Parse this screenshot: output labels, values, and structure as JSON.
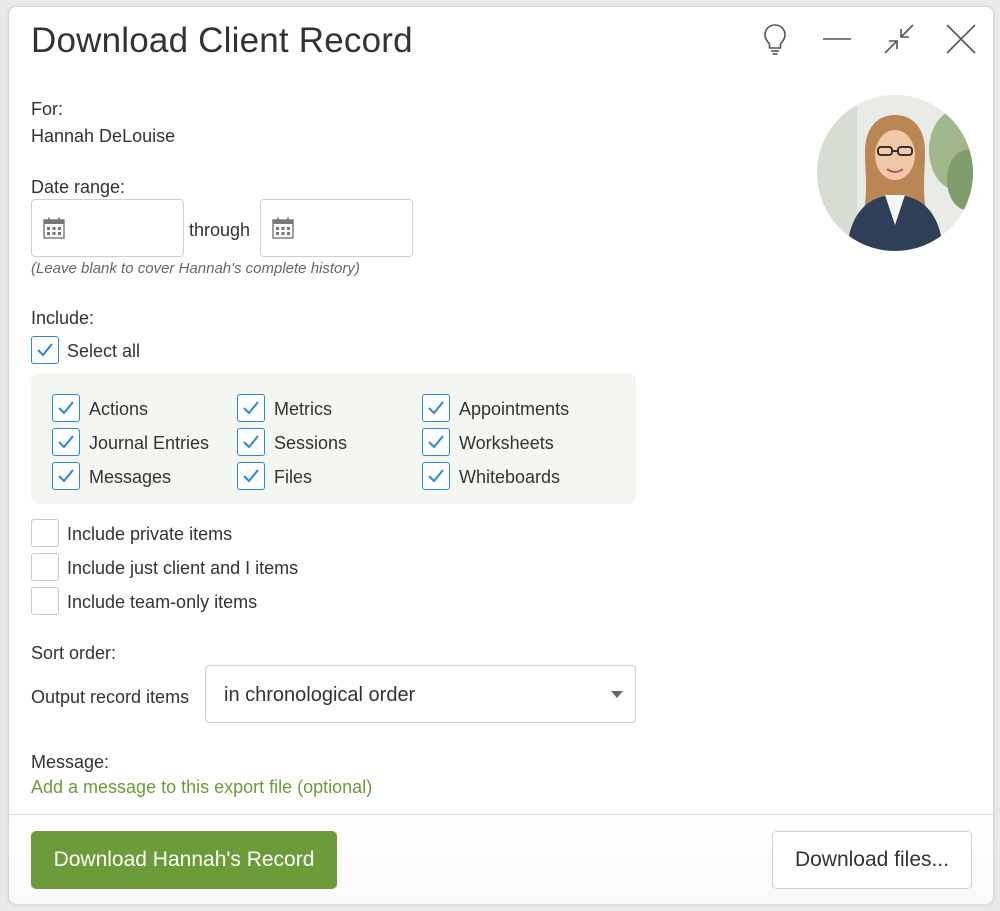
{
  "dialog": {
    "title": "Download Client Record",
    "controls": [
      "lightbulb-icon",
      "minimize-icon",
      "collapse-icon",
      "close-icon"
    ]
  },
  "for": {
    "label": "For:",
    "client_name": "Hannah DeLouise"
  },
  "date_range": {
    "label": "Date range:",
    "start_value": "",
    "end_value": "",
    "separator": "through",
    "hint": "(Leave blank to cover Hannah's complete history)"
  },
  "include": {
    "label": "Include:",
    "select_all": {
      "label": "Select all",
      "checked": true
    },
    "items": [
      {
        "label": "Actions",
        "checked": true
      },
      {
        "label": "Metrics",
        "checked": true
      },
      {
        "label": "Appointments",
        "checked": true
      },
      {
        "label": "Journal Entries",
        "checked": true
      },
      {
        "label": "Sessions",
        "checked": true
      },
      {
        "label": "Worksheets",
        "checked": true
      },
      {
        "label": "Messages",
        "checked": true
      },
      {
        "label": "Files",
        "checked": true
      },
      {
        "label": "Whiteboards",
        "checked": true
      }
    ],
    "privacy_options": [
      {
        "label": "Include private items",
        "checked": false
      },
      {
        "label": "Include just client and I items",
        "checked": false
      },
      {
        "label": "Include team-only items",
        "checked": false
      }
    ]
  },
  "sort": {
    "label": "Sort order:",
    "output_label": "Output record items",
    "selected": "in chronological order"
  },
  "message": {
    "label": "Message:",
    "link": "Add a message to this export file (optional)"
  },
  "footer": {
    "primary_button": "Download Hannah's Record",
    "secondary_button": "Download files..."
  },
  "colors": {
    "accent_green": "#6d9b3a",
    "checkbox_blue": "#2b88d8",
    "include_bg": "#f4f7f1"
  }
}
